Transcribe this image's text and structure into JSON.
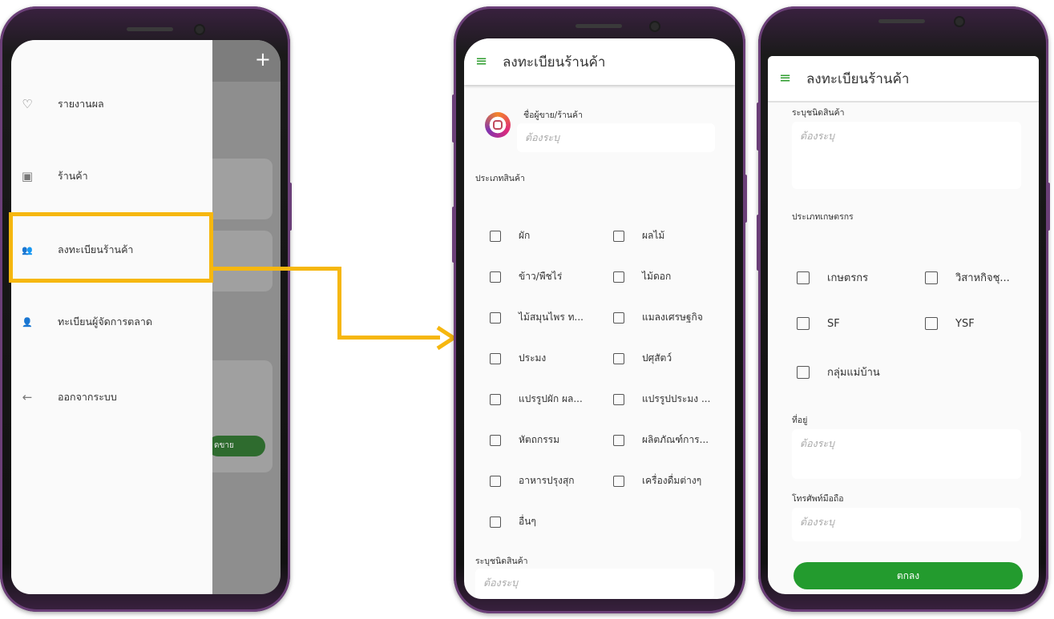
{
  "panel1": {
    "plus_label": "+",
    "drawer_items": [
      {
        "icon": "heart-outline-icon",
        "glyph": "♡",
        "label": "รายงานผล"
      },
      {
        "icon": "shop-icon",
        "glyph": "▣",
        "label": "ร้านค้า"
      },
      {
        "icon": "people-icon",
        "glyph": "👥",
        "label": "ลงทะเบียนร้านค้า"
      },
      {
        "icon": "person-icon",
        "glyph": "👤",
        "label": "ทะเบียนผู้จัดการตลาด"
      },
      {
        "icon": "arrow-left-icon",
        "glyph": "←",
        "label": "ออกจากระบบ"
      }
    ],
    "dim_button_label": "ดขาย",
    "highlight_color": "#f6b70f"
  },
  "panel2": {
    "title": "ลงทะเบียนร้านค้า",
    "shop_name_label": "ชื่อผู้ขาย/ร้านค้า",
    "shop_name_placeholder": "ต้องระบุ",
    "category_label": "ประเภทสินค้า",
    "categories": [
      {
        "label": "ผัก",
        "checked": false
      },
      {
        "label": "ผลไม้",
        "checked": false
      },
      {
        "label": "ข้าว/พืชไร่",
        "checked": false
      },
      {
        "label": "ไม้ดอก",
        "checked": false
      },
      {
        "label": "ไม้สมุนไพร ท...",
        "checked": false
      },
      {
        "label": "แมลงเศรษฐกิจ",
        "checked": false
      },
      {
        "label": "ประมง",
        "checked": false
      },
      {
        "label": "ปศุสัตว์",
        "checked": false
      },
      {
        "label": "แปรรูปผัก ผล...",
        "checked": false
      },
      {
        "label": "แปรรูปประมง ...",
        "checked": false
      },
      {
        "label": "หัตถกรรม",
        "checked": false
      },
      {
        "label": "ผลิตภัณฑ์การ...",
        "checked": false
      },
      {
        "label": "อาหารปรุงสุก",
        "checked": false
      },
      {
        "label": "เครื่องดื่มต่างๆ",
        "checked": false
      },
      {
        "label": "อื่นๆ",
        "checked": false
      }
    ],
    "product_type_label": "ระบุชนิดสินค้า",
    "product_type_placeholder": "ต้องระบุ"
  },
  "panel3": {
    "title": "ลงทะเบียนร้านค้า",
    "product_type_label": "ระบุชนิดสินค้า",
    "product_type_placeholder": "ต้องระบุ",
    "farmer_type_label": "ประเภทเกษตรกร",
    "farmer_types": [
      {
        "label": "เกษตรกร",
        "checked": false
      },
      {
        "label": "วิสาหกิจชุ...",
        "checked": false
      },
      {
        "label": "SF",
        "checked": false
      },
      {
        "label": "YSF",
        "checked": false
      },
      {
        "label": "กลุ่มแม่บ้าน",
        "checked": false
      }
    ],
    "address_label": "ที่อยู่",
    "address_placeholder": "ต้องระบุ",
    "phone_label": "โทรศัพท์มือถือ",
    "phone_placeholder": "ต้องระบุ",
    "submit_label": "ตกลง"
  },
  "colors": {
    "accent_green": "#239b2e",
    "highlight_yellow": "#f6b70f",
    "phone_frame_purple": "#6b3f78"
  }
}
